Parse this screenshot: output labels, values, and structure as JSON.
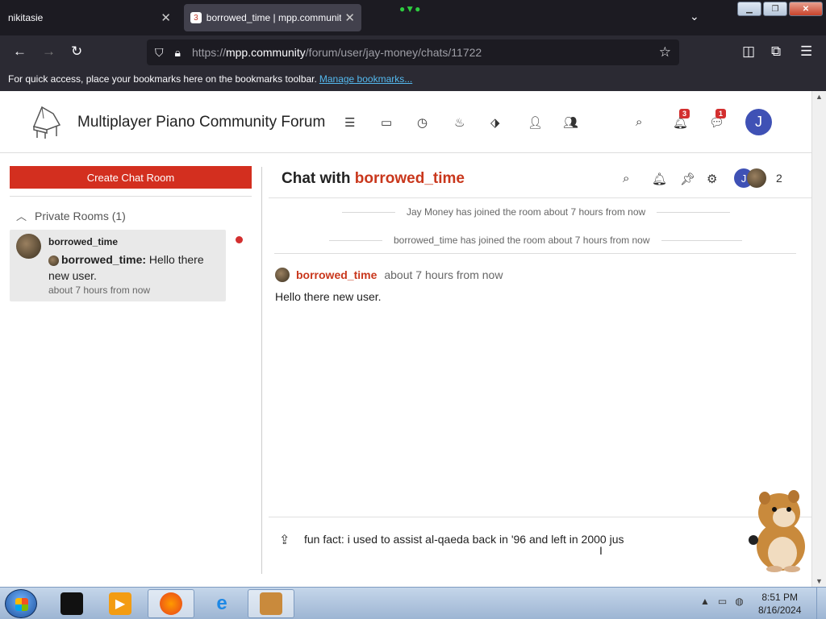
{
  "browser": {
    "tabs": [
      {
        "title": "nikitasie",
        "active": false
      },
      {
        "title": "borrowed_time | mpp.community",
        "active": true,
        "favicon_badge": "3"
      }
    ],
    "url": {
      "protocol": "https://",
      "host": "mpp.community",
      "path": "/forum/user/jay-money/chats/11722"
    },
    "bookmarks_bar": {
      "text": "For quick access, place your bookmarks here on the bookmarks toolbar.",
      "link": "Manage bookmarks..."
    }
  },
  "forum": {
    "title": "Multiplayer Piano Community Forum",
    "notification_count": "3",
    "chat_count": "1",
    "user_initial": "J",
    "brand_color": "#c9371c"
  },
  "sidebar": {
    "create_button": "Create Chat Room",
    "section_label": "Private Rooms (1)",
    "rooms": [
      {
        "name": "borrowed_time",
        "last_author": "borrowed_time:",
        "last_message": "Hello there new user.",
        "time": "about 7 hours from now",
        "unread": true
      }
    ]
  },
  "chat": {
    "title_prefix": "Chat with",
    "title_user": "borrowed_time",
    "user_initial": "J",
    "user_count": "2",
    "system_messages": [
      "Jay Money has joined the room about 7 hours from now",
      "borrowed_time has joined the room about 7 hours from now"
    ],
    "messages": [
      {
        "author": "borrowed_time",
        "time": "about 7 hours from now",
        "body": "Hello there new user."
      }
    ],
    "composer_value": "fun fact: i used to assist al-qaeda back in '96 and left in 2000 jus"
  },
  "taskbar": {
    "time": "8:51 PM",
    "date": "8/16/2024",
    "apps": [
      "media-center",
      "media-player",
      "firefox",
      "internet-explorer",
      "box-app"
    ]
  }
}
